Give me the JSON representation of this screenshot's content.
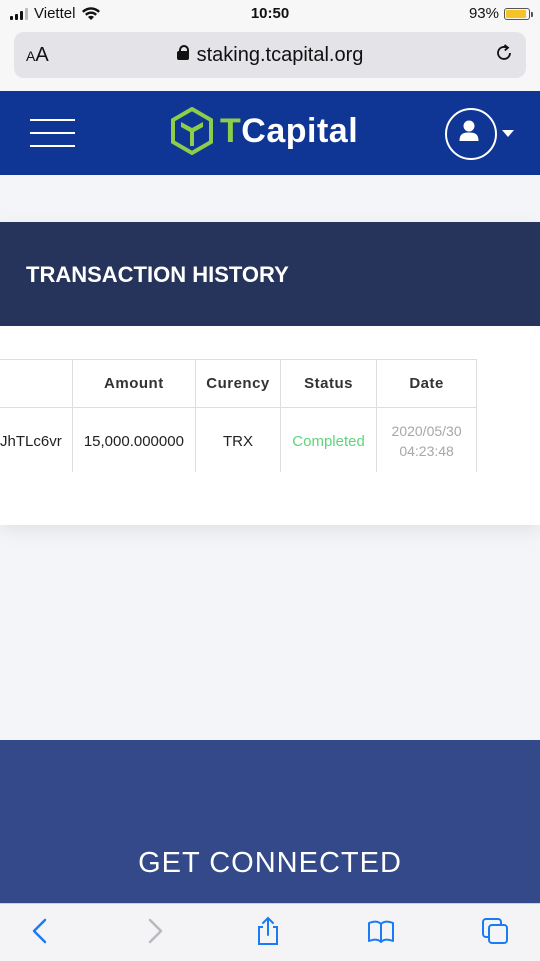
{
  "status_bar": {
    "carrier": "Viettel",
    "time": "10:50",
    "battery": "93%",
    "battery_level": 0.93
  },
  "browser": {
    "text_size_label": "AA",
    "url": "staking.tcapital.org"
  },
  "header": {
    "logo_prefix": "T",
    "logo_rest": "Capital"
  },
  "history": {
    "title": "TRANSACTION HISTORY",
    "columns": [
      "",
      "Amount",
      "Curency",
      "Status",
      "Date"
    ],
    "rows": [
      {
        "id": "JhTLc6vr",
        "amount": "15,000.000000",
        "currency": "TRX",
        "status": "Completed",
        "date": "2020/05/30",
        "time": "04:23:48"
      }
    ]
  },
  "footer": {
    "title": "GET CONNECTED"
  },
  "colors": {
    "header_bg": "#0f3694",
    "card_head_bg": "#26345b",
    "footer_bg": "#33498a",
    "status_completed": "#5cd67a",
    "logo_accent": "#8ccd4a"
  }
}
